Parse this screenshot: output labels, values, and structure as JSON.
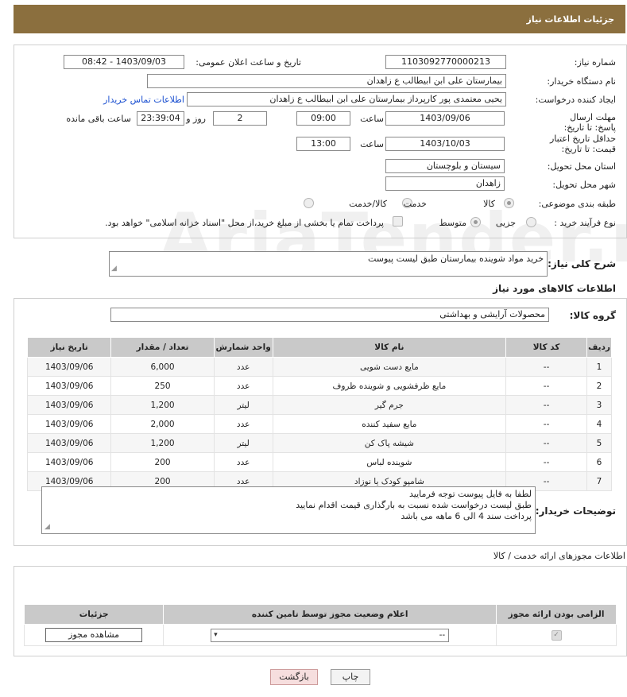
{
  "header": {
    "title": "جزئیات اطلاعات نیاز"
  },
  "form": {
    "need_number_label": "شماره نیاز:",
    "need_number": "1103092770000213",
    "announce_label": "تاریخ و ساعت اعلان عمومی:",
    "announce_value": "1403/09/03 - 08:42",
    "buyer_org_label": "نام دستگاه خریدار:",
    "buyer_org": "بیمارستان علی ابن ابیطالب  ع  زاهدان",
    "creator_label": "ایجاد کننده درخواست:",
    "creator": "یحیی معتمدی پور کارپرداز بیمارستان علی ابن ابیطالب  ع  زاهدان",
    "contact_link": "اطلاعات تماس خریدار",
    "reply_deadline_label": "مهلت ارسال پاسخ: تا تاریخ:",
    "reply_date": "1403/09/06",
    "time_label": "ساعت",
    "reply_time": "09:00",
    "days_value": "2",
    "days_label": "روز و",
    "remaining_time": "23:39:04",
    "remaining_label": "ساعت باقی مانده",
    "price_validity_label": "حداقل تاریخ اعتبار قیمت: تا تاریخ:",
    "price_date": "1403/10/03",
    "price_time": "13:00",
    "province_label": "استان محل تحویل:",
    "province": "سیستان و بلوچستان",
    "city_label": "شهر محل تحویل:",
    "city": "زاهدان",
    "category_label": "طبقه بندی موضوعی:",
    "category_options": [
      "کالا",
      "خدمت",
      "کالا/خدمت"
    ],
    "process_label": "نوع فرآیند خرید :",
    "process_options": [
      "جزیی",
      "متوسط"
    ],
    "payment_note": "پرداخت تمام یا بخشی از مبلغ خرید،از محل \"اسناد خزانه اسلامی\" خواهد بود."
  },
  "summary": {
    "label": "شرح کلی نیاز:",
    "value": "خرید مواد شوینده بیمارستان طبق لیست پیوست"
  },
  "goods": {
    "section_title": "اطلاعات کالاهای مورد نیاز",
    "group_label": "گروه کالا:",
    "group_value": "محصولات آرایشی و بهداشتی",
    "columns": [
      "ردیف",
      "کد کالا",
      "نام کالا",
      "واحد شمارش",
      "تعداد / مقدار",
      "تاریخ نیاز"
    ],
    "rows": [
      {
        "idx": "1",
        "code": "--",
        "name": "مایع دست شویی",
        "unit": "عدد",
        "qty": "6,000",
        "date": "1403/09/06"
      },
      {
        "idx": "2",
        "code": "--",
        "name": "مایع ظرفشویی و شوینده ظروف",
        "unit": "عدد",
        "qty": "250",
        "date": "1403/09/06"
      },
      {
        "idx": "3",
        "code": "--",
        "name": "جرم گیر",
        "unit": "لیتر",
        "qty": "1,200",
        "date": "1403/09/06"
      },
      {
        "idx": "4",
        "code": "--",
        "name": "مایع سفید کننده",
        "unit": "عدد",
        "qty": "2,000",
        "date": "1403/09/06"
      },
      {
        "idx": "5",
        "code": "--",
        "name": "شیشه پاک کن",
        "unit": "لیتر",
        "qty": "1,200",
        "date": "1403/09/06"
      },
      {
        "idx": "6",
        "code": "--",
        "name": "شوینده لباس",
        "unit": "عدد",
        "qty": "200",
        "date": "1403/09/06"
      },
      {
        "idx": "7",
        "code": "--",
        "name": "شامپو کودک یا نوزاد",
        "unit": "عدد",
        "qty": "200",
        "date": "1403/09/06"
      }
    ]
  },
  "buyer_notes": {
    "label": "توضیحات خریدار:",
    "lines": [
      "لطفا به فایل پیوست توجه فرمایید",
      "طبق لیست درخواست شده نسبت به بارگذاری قیمت اقدام نمایید",
      "پرداخت سند 4 الی 6 ماهه می باشد"
    ]
  },
  "permits": {
    "section_title": "اطلاعات مجوزهای ارائه خدمت / کالا",
    "columns": [
      "الزامی بودن ارائه مجوز",
      "اعلام وضعیت مجوز توسط تامین کننده",
      "جزئیات"
    ],
    "select_value": "--",
    "view_button": "مشاهده مجوز"
  },
  "footer": {
    "print_button": "چاپ",
    "back_button": "بازگشت"
  },
  "watermark": "AriaTender.neT"
}
